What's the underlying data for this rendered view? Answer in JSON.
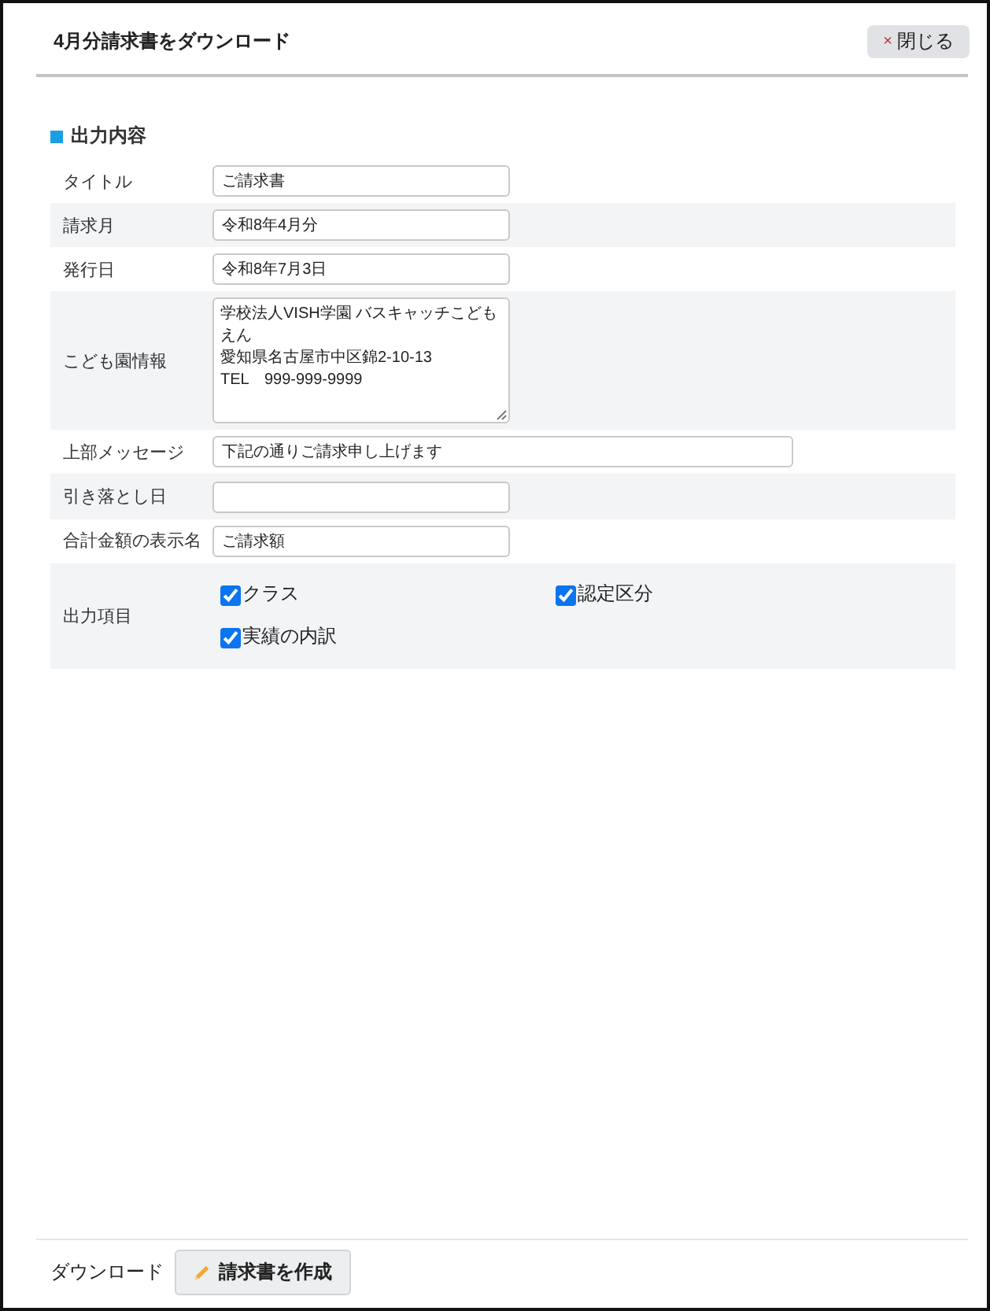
{
  "dialog": {
    "title": "4月分請求書をダウンロード",
    "close_button": {
      "icon": "×",
      "label": "閉じる"
    }
  },
  "section": {
    "heading": "出力内容",
    "fields": [
      {
        "kind": "input",
        "label": "タイトル",
        "value": "ご請求書"
      },
      {
        "kind": "input",
        "label": "請求月",
        "value": "令和8年4月分"
      },
      {
        "kind": "input",
        "label": "発行日",
        "value": "令和8年7月3日"
      },
      {
        "kind": "textarea",
        "label": "こども園情報",
        "lines": [
          "学校法人VISH学園 バスキャッチこどもえん",
          "愛知県名古屋市中区錦2-10-13",
          "TEL　999-999-9999"
        ]
      },
      {
        "kind": "wide_input",
        "label": "上部メッセージ",
        "value": "下記の通りご請求申し上げます"
      },
      {
        "kind": "input",
        "label": "引き落とし日"
      },
      {
        "kind": "input",
        "label": "合計金額の表示名",
        "value": "ご請求額"
      },
      {
        "kind": "checkboxes",
        "label": "出力項目",
        "options": [
          {
            "label": "クラス",
            "checked": true
          },
          {
            "label": "認定区分",
            "checked": true
          },
          {
            "label": "実績の内訳",
            "checked": true
          }
        ]
      }
    ]
  },
  "footer": {
    "label": "ダウンロード",
    "button": {
      "label": "請求書を作成"
    }
  }
}
